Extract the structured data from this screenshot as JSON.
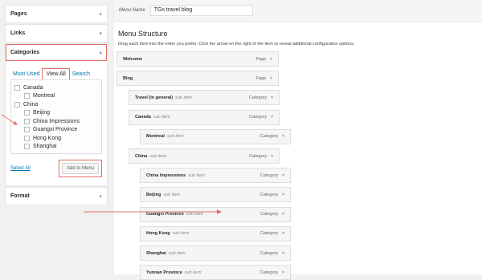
{
  "accordion": {
    "pages": "Pages",
    "links": "Links",
    "categories": "Categories",
    "format": "Format"
  },
  "categories_panel": {
    "tabs": [
      "Most Used",
      "View All",
      "Search"
    ],
    "items": [
      {
        "label": "Canada",
        "level": 0
      },
      {
        "label": "Montreal",
        "level": 1
      },
      {
        "label": "China",
        "level": 0
      },
      {
        "label": "Beijing",
        "level": 1
      },
      {
        "label": "China Impressions",
        "level": 1
      },
      {
        "label": "Guangxi Province",
        "level": 1
      },
      {
        "label": "Hong Kong",
        "level": 1
      },
      {
        "label": "Shanghai",
        "level": 1
      }
    ],
    "select_all": "Select All",
    "add_to_menu": "Add to Menu"
  },
  "menu": {
    "name_label": "Menu Name",
    "name_value": "TGs travel blog",
    "structure_title": "Menu Structure",
    "structure_desc": "Drag each item into the order you prefer. Click the arrow on the right of the item to reveal additional configuration options.",
    "items": [
      {
        "title": "Welcome",
        "sub": "",
        "type": "Page",
        "depth": 0
      },
      {
        "title": "Blog",
        "sub": "",
        "type": "Page",
        "depth": 0
      },
      {
        "title": "Travel (in general)",
        "sub": "sub item",
        "type": "Category",
        "depth": 1
      },
      {
        "title": "Canada",
        "sub": "sub item",
        "type": "Category",
        "depth": 1
      },
      {
        "title": "Montreal",
        "sub": "sub item",
        "type": "Category",
        "depth": 2
      },
      {
        "title": "China",
        "sub": "sub item",
        "type": "Category",
        "depth": 1
      },
      {
        "title": "China Impressions",
        "sub": "sub item",
        "type": "Category",
        "depth": 2
      },
      {
        "title": "Beijing",
        "sub": "sub item",
        "type": "Category",
        "depth": 2
      },
      {
        "title": "Guangxi Province",
        "sub": "sub item",
        "type": "Category",
        "depth": 2
      },
      {
        "title": "Hong Kong",
        "sub": "sub item",
        "type": "Category",
        "depth": 2
      },
      {
        "title": "Shanghai",
        "sub": "sub item",
        "type": "Category",
        "depth": 2
      },
      {
        "title": "Yunnan Province",
        "sub": "sub item",
        "type": "Category",
        "depth": 2
      }
    ]
  },
  "colors": {
    "highlight": "#e0705f",
    "link": "#0073aa"
  }
}
